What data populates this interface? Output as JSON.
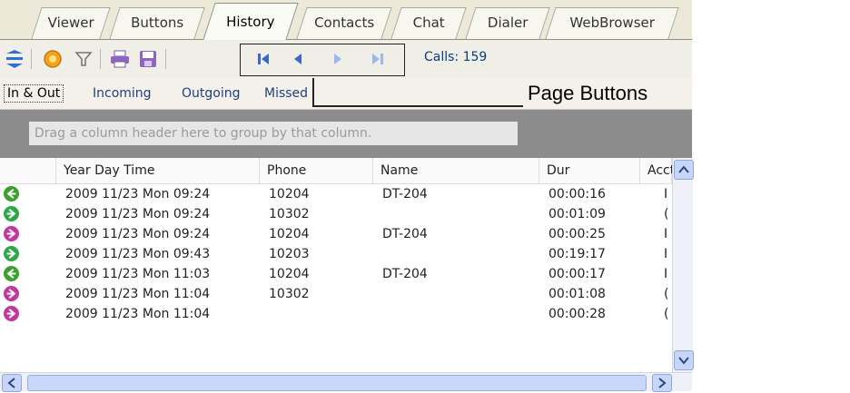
{
  "tabs": [
    "Viewer",
    "Buttons",
    "History",
    "Contacts",
    "Chat",
    "Dialer",
    "WebBrowser"
  ],
  "active_tab": "History",
  "toolbar": {
    "icons": [
      "collapse-icon",
      "settings-icon",
      "filter-icon",
      "print-icon",
      "save-icon"
    ],
    "pager": [
      "first-page-icon",
      "previous-page-icon",
      "next-page-icon",
      "last-page-icon"
    ],
    "calls_label": "Calls: 159"
  },
  "subtabs": [
    "In & Out",
    "Incoming",
    "Outgoing",
    "Missed"
  ],
  "group_hint": "Drag a column header here to group by that column.",
  "columns": [
    "Year  Day  Time",
    "Phone",
    "Name",
    "Dur",
    "Acct"
  ],
  "rows": [
    {
      "dir": "incoming",
      "time": "2009 11/23 Mon 09:24",
      "phone": "10204",
      "name": "DT-204",
      "dur": "00:00:16",
      "extra": "I"
    },
    {
      "dir": "outgoing",
      "time": "2009 11/23 Mon 09:24",
      "phone": "10302",
      "name": "",
      "dur": "00:01:09",
      "extra": "("
    },
    {
      "dir": "missed",
      "time": "2009 11/23 Mon 09:24",
      "phone": "10204",
      "name": "DT-204",
      "dur": "00:00:25",
      "extra": "I"
    },
    {
      "dir": "outgoing",
      "time": "2009 11/23 Mon 09:43",
      "phone": "10203",
      "name": "",
      "dur": "00:19:17",
      "extra": "I"
    },
    {
      "dir": "incoming",
      "time": "2009 11/23 Mon 11:03",
      "phone": "10204",
      "name": "DT-204",
      "dur": "00:00:17",
      "extra": "I"
    },
    {
      "dir": "missed",
      "time": "2009 11/23 Mon 11:04",
      "phone": "10302",
      "name": "",
      "dur": "00:01:08",
      "extra": "("
    },
    {
      "dir": "missed",
      "time": "2009 11/23 Mon 11:04",
      "phone": "",
      "name": "",
      "dur": "00:00:28",
      "extra": "("
    }
  ],
  "dir_colors": {
    "incoming": "#3aa12a",
    "outgoing": "#2fa84a",
    "missed": "#c2369e"
  },
  "callout": "Page Buttons"
}
